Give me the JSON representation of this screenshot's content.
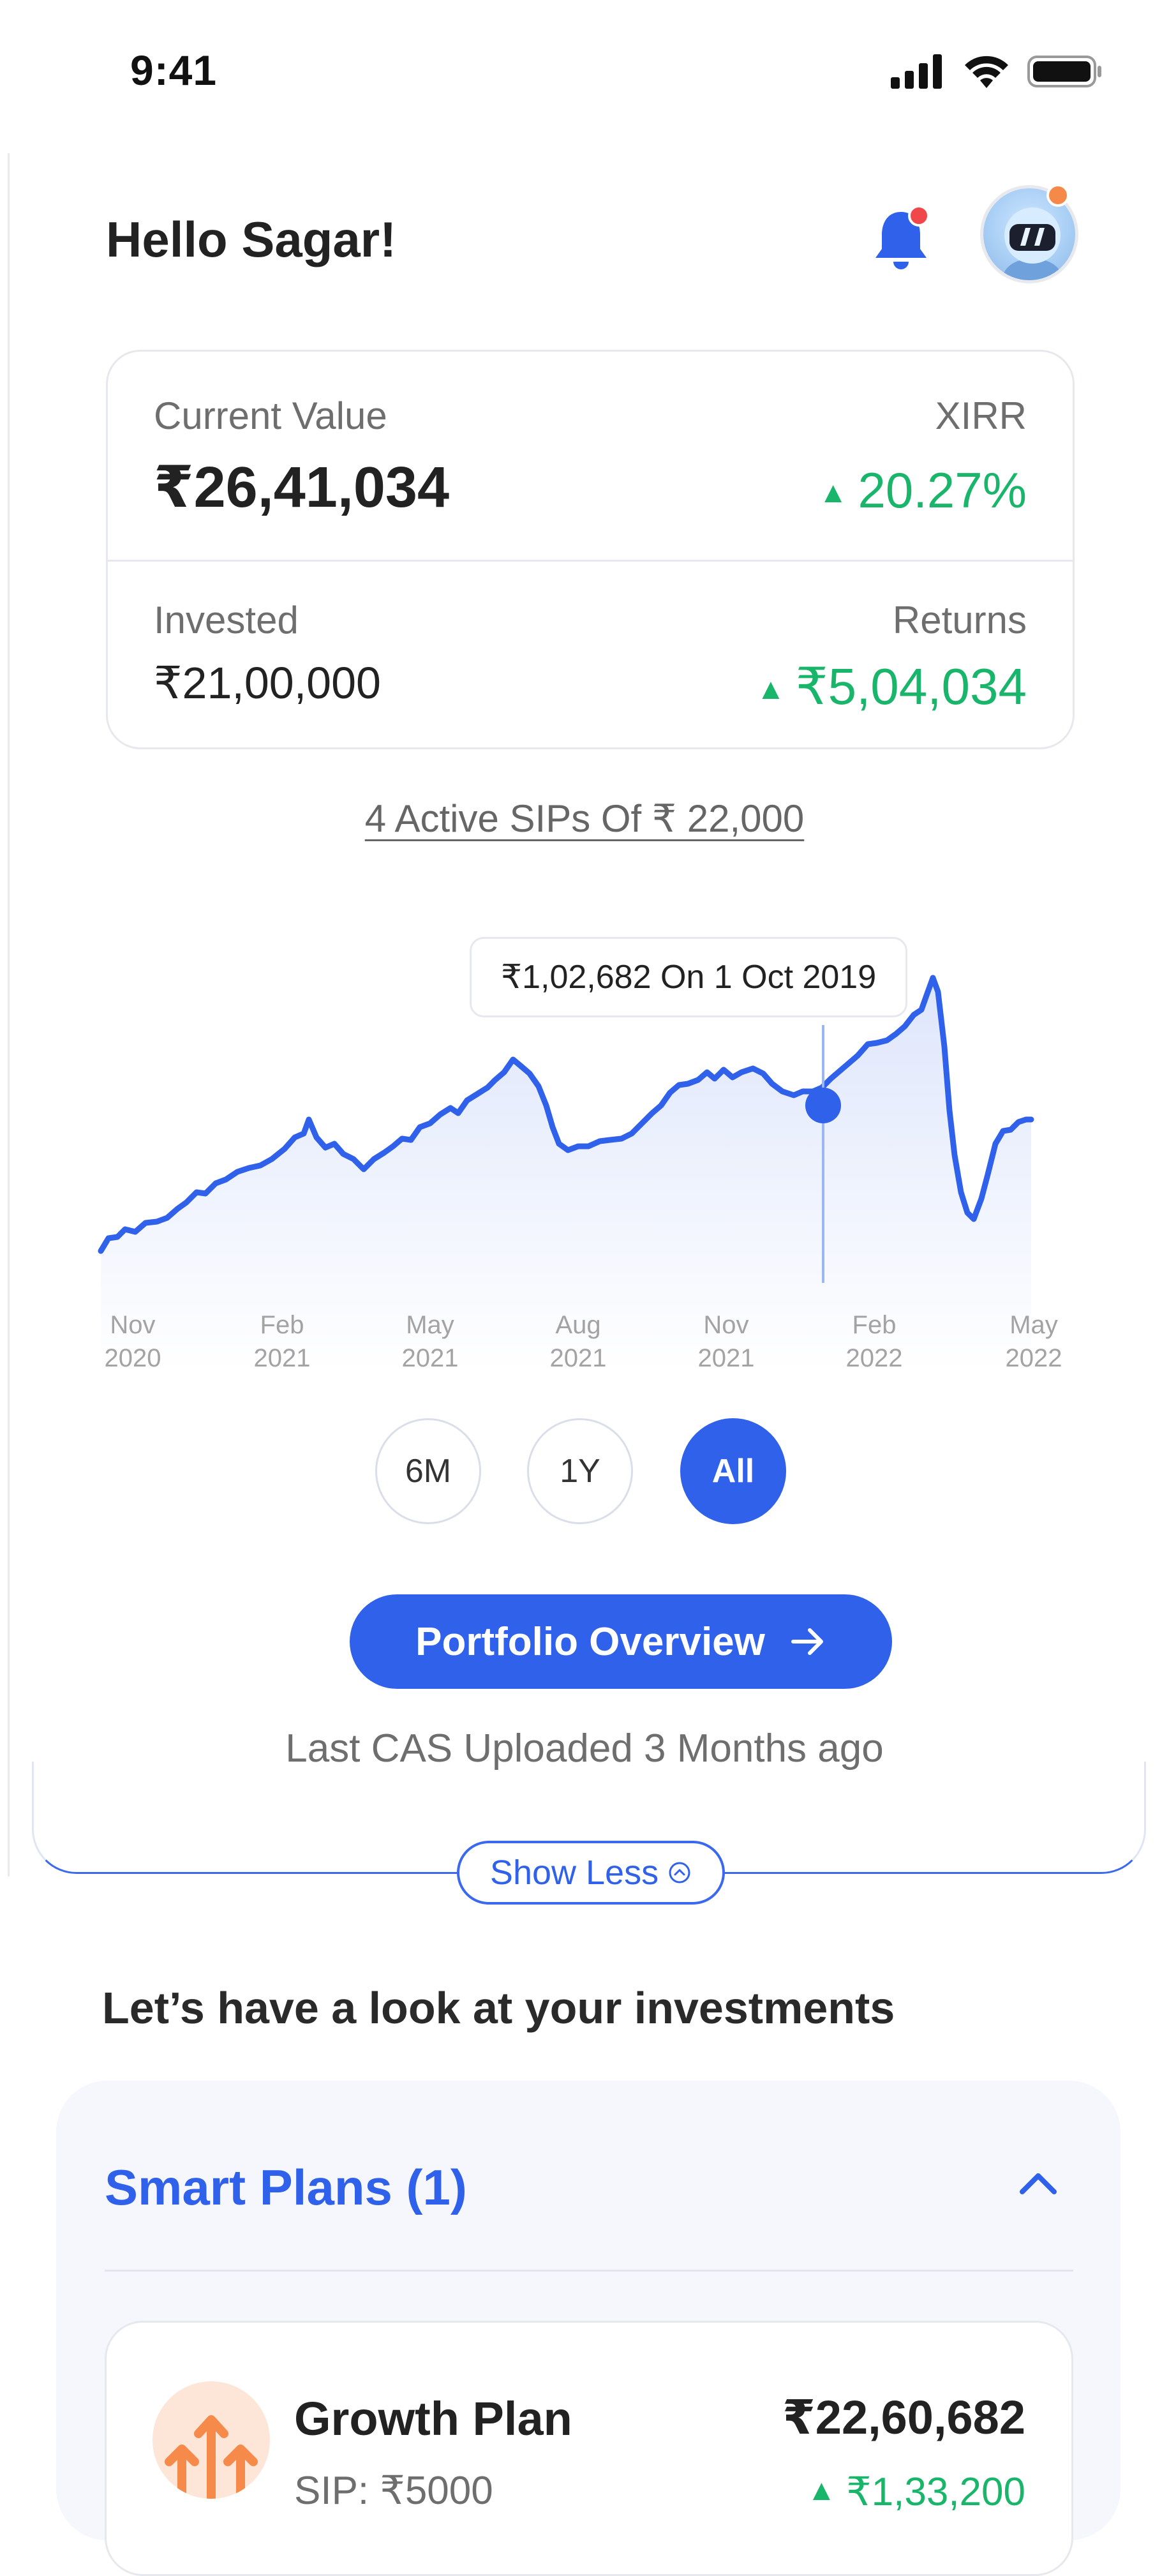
{
  "status_bar": {
    "time": "9:41"
  },
  "header": {
    "greeting": "Hello Sagar!"
  },
  "summary": {
    "current_value_label": "Current Value",
    "current_value": "₹26,41,034",
    "xirr_label": "XIRR",
    "xirr_value": "20.27%",
    "invested_label": "Invested",
    "invested_value": "₹21,00,000",
    "returns_label": "Returns",
    "returns_value": "₹5,04,034"
  },
  "sips_link": "4 Active SIPs Of ₹ 22,000",
  "chart_data": {
    "type": "area",
    "x": [
      "Nov 2020",
      "Feb 2021",
      "May 2021",
      "Aug 2021",
      "Nov 2021",
      "Feb 2022",
      "May 2022"
    ],
    "tooltip": "₹1,02,682 On 1 Oct 2019",
    "color": "#2f61ea"
  },
  "chart_labels": [
    {
      "month": "Nov",
      "year": "2020"
    },
    {
      "month": "Feb",
      "year": "2021"
    },
    {
      "month": "May",
      "year": "2021"
    },
    {
      "month": "Aug",
      "year": "2021"
    },
    {
      "month": "Nov",
      "year": "2021"
    },
    {
      "month": "Feb",
      "year": "2022"
    },
    {
      "month": "May",
      "year": "2022"
    }
  ],
  "range_buttons": [
    {
      "label": "6M",
      "active": false
    },
    {
      "label": "1Y",
      "active": false
    },
    {
      "label": "All",
      "active": true
    }
  ],
  "cta": {
    "label": "Portfolio Overview"
  },
  "cas_note": "Last CAS Uploaded 3 Months ago",
  "show_less": "Show Less",
  "investments": {
    "title": "Let’s have a look at your investments",
    "plans_title": "Smart Plans (1)",
    "plan": {
      "name": "Growth Plan",
      "sip": "SIP: ₹5000",
      "value": "₹22,60,682",
      "return": "₹1,33,200"
    }
  },
  "colors": {
    "primary": "#2f61ea",
    "positive": "#19b56a",
    "notification": "#f0484a",
    "avatar_badge": "#f5894a"
  }
}
